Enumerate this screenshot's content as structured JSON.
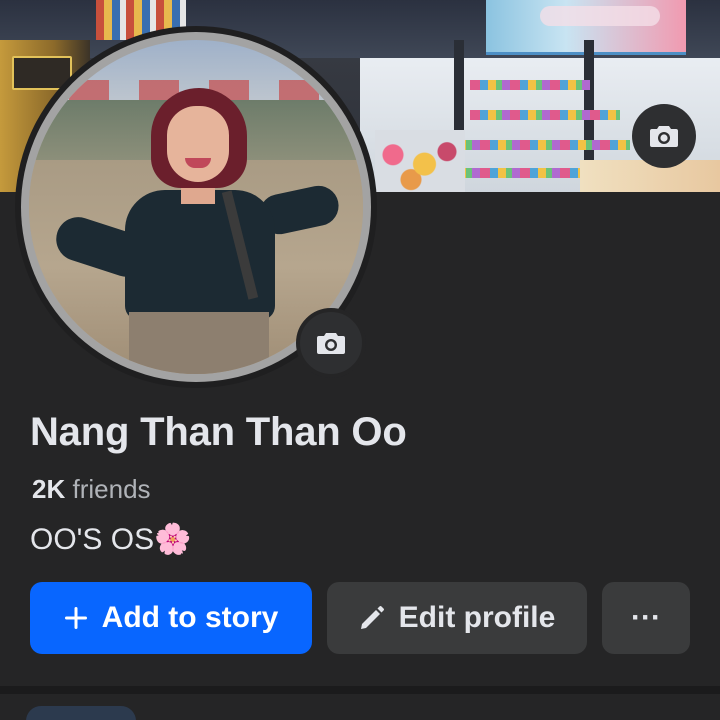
{
  "profile": {
    "name": "Nang Than Than Oo",
    "friends_count": "2K",
    "friends_label": "friends",
    "bio": "OO'S OS🌸"
  },
  "actions": {
    "add_story_label": "Add to story",
    "add_story_icon": "plus-icon",
    "edit_profile_label": "Edit profile",
    "edit_profile_icon": "pencil-icon",
    "more_label": "···"
  },
  "icons": {
    "cover_camera": "camera-icon",
    "avatar_camera": "camera-icon"
  },
  "colors": {
    "background": "#252526",
    "primary_button": "#0866ff",
    "secondary_button": "#3a3b3c",
    "text_primary": "#e4e6eb",
    "text_secondary": "#b0b3b8"
  }
}
